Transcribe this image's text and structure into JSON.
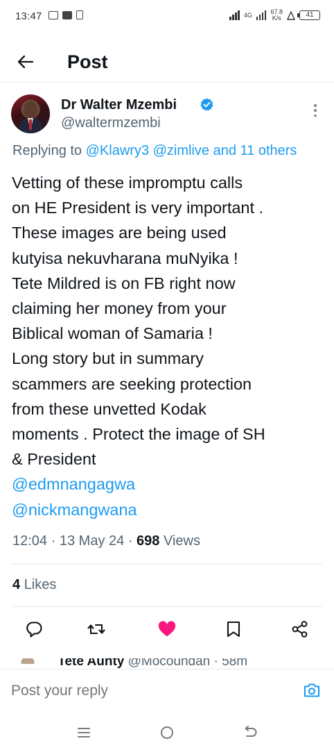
{
  "status_bar": {
    "time": "13:47",
    "network": "4G",
    "speed": "67.8",
    "speed_unit": "K/s",
    "battery": "41"
  },
  "header": {
    "back_icon": "arrow-left-icon",
    "title": "Post"
  },
  "post": {
    "author_name": "Dr Walter Mzembi",
    "author_handle": "@waltermzembi",
    "verified_icon": "verified-badge-icon",
    "replying_prefix": "Replying to",
    "replying_mentions": "@Klawry3 @zimlive and 11 others",
    "lines": [
      "Vetting of these impromptu calls",
      "on HE President is very important .",
      "These images are being used",
      "kutyisa nekuvharana muNyika !",
      "Tete Mildred is on FB right now",
      "claiming her money from your",
      "Biblical woman of Samaria !",
      "Long story but in summary",
      "scammers are seeking protection",
      "from these unvetted Kodak",
      "moments . Protect the image of SH",
      "& President"
    ],
    "mentions": [
      "@edmnangagwa",
      "@nickmangwana"
    ],
    "time": "12:04",
    "date": "13 May 24",
    "views_count": "698",
    "views_label": "Views",
    "likes_count": "4",
    "likes_label": "Likes",
    "like_color": "#f91880",
    "accent_color": "#1d9bf0"
  },
  "actions": {
    "reply_icon": "reply-icon",
    "retweet_icon": "retweet-icon",
    "like_icon": "heart-filled-icon",
    "bookmark_icon": "bookmark-icon",
    "share_icon": "share-icon"
  },
  "next_reply": {
    "name": "Tete Aunty",
    "handle": "@Mocoundah",
    "time": "58m"
  },
  "reply_bar": {
    "placeholder": "Post your reply",
    "camera_icon": "camera-icon"
  },
  "nav": {
    "menu_icon": "menu-icon",
    "home_icon": "home-circle-icon",
    "back_icon": "back-icon"
  }
}
